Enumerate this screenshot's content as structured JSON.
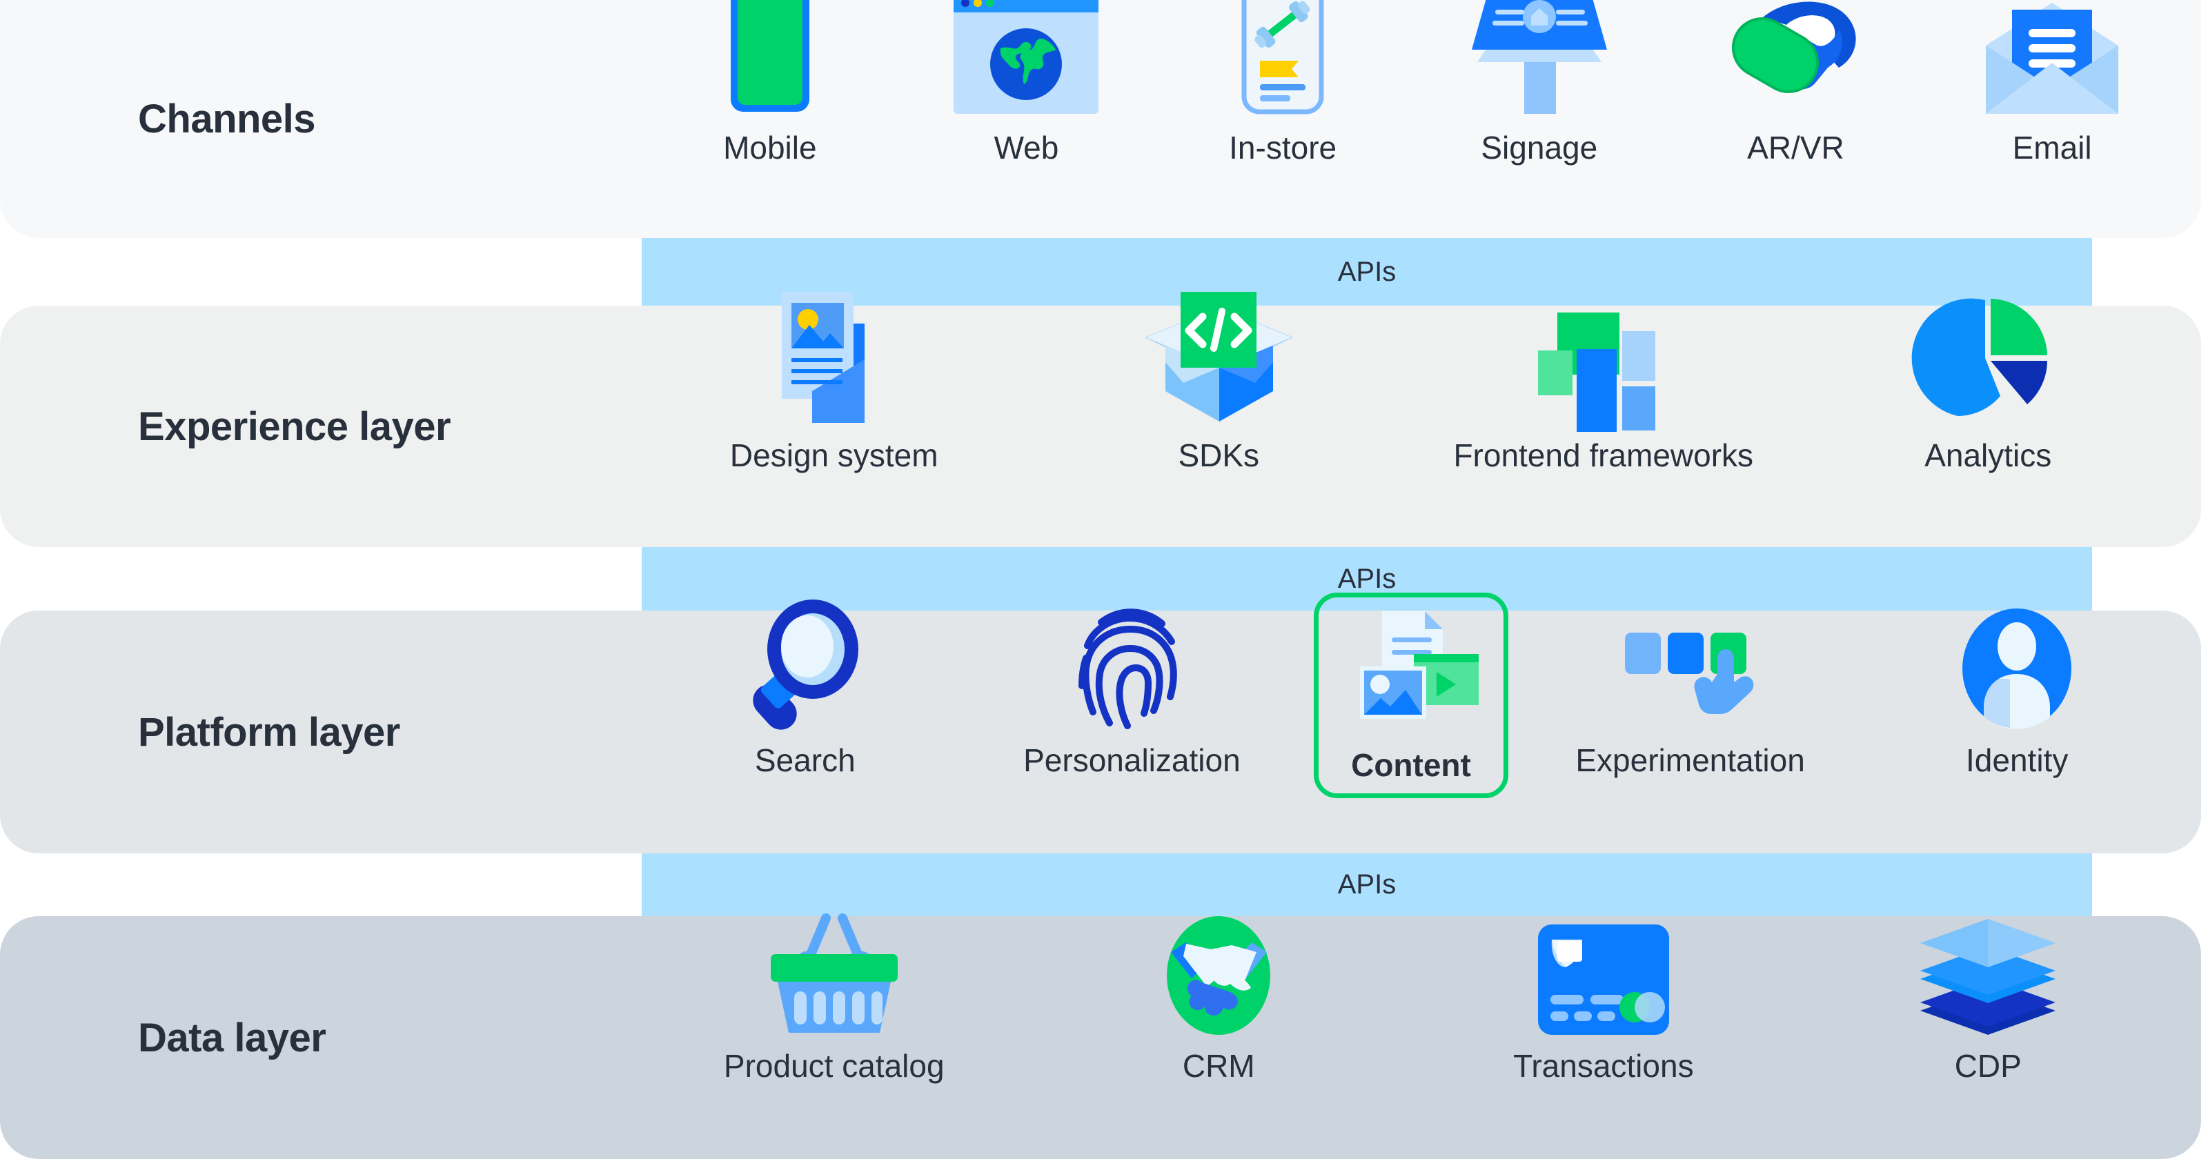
{
  "layers": [
    {
      "id": "channels",
      "title": "Channels",
      "items": [
        {
          "label": "Mobile",
          "icon": "mobile-phone-icon"
        },
        {
          "label": "Web",
          "icon": "browser-globe-icon"
        },
        {
          "label": "In-store",
          "icon": "in-store-phone-icon"
        },
        {
          "label": "Signage",
          "icon": "kiosk-signage-icon"
        },
        {
          "label": "AR/VR",
          "icon": "vr-headset-icon"
        },
        {
          "label": "Email",
          "icon": "email-envelope-icon"
        }
      ]
    },
    {
      "id": "experience",
      "title": "Experience layer",
      "items": [
        {
          "label": "Design system",
          "icon": "design-document-icon"
        },
        {
          "label": "SDKs",
          "icon": "code-box-icon"
        },
        {
          "label": "Frontend frameworks",
          "icon": "blocks-grid-icon"
        },
        {
          "label": "Analytics",
          "icon": "pie-chart-icon"
        }
      ]
    },
    {
      "id": "platform",
      "title": "Platform layer",
      "items": [
        {
          "label": "Search",
          "icon": "magnifier-icon",
          "highlighted": false
        },
        {
          "label": "Personalization",
          "icon": "fingerprint-icon",
          "highlighted": false
        },
        {
          "label": "Content",
          "icon": "content-media-icon",
          "highlighted": true
        },
        {
          "label": "Experimentation",
          "icon": "ab-test-cursor-icon",
          "highlighted": false
        },
        {
          "label": "Identity",
          "icon": "user-avatar-icon",
          "highlighted": false
        }
      ]
    },
    {
      "id": "data",
      "title": "Data layer",
      "items": [
        {
          "label": "Product catalog",
          "icon": "shopping-basket-icon"
        },
        {
          "label": "CRM",
          "icon": "handshake-icon"
        },
        {
          "label": "Transactions",
          "icon": "credit-card-icon"
        },
        {
          "label": "CDP",
          "icon": "stacked-layers-icon"
        }
      ]
    }
  ],
  "connectors": [
    {
      "label": "APIs"
    },
    {
      "label": "APIs"
    },
    {
      "label": "APIs"
    }
  ],
  "colors": {
    "band_channels": "#f6f8fa",
    "band_experience": "#eff0f0",
    "band_platform": "#e2e6e9",
    "band_data": "#ccd4dd",
    "api_band": "#ace0ff",
    "highlight_border": "#00d26a",
    "text": "#28303c",
    "blue": "#0b7bff",
    "blue_dark": "#1433c4",
    "blue_light": "#7cb8ff",
    "blue_pale": "#bfdfff",
    "green": "#00d26a",
    "green_light": "#4fe39b",
    "yellow": "#ffd000"
  }
}
